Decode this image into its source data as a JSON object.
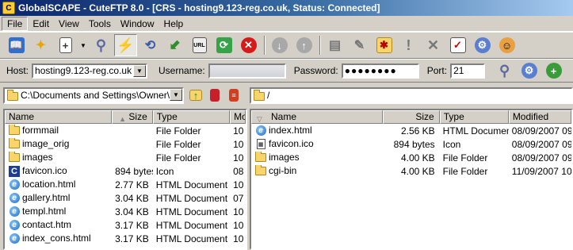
{
  "window": {
    "title": "GlobalSCAPE - CuteFTP 8.0 - [CRS - hosting9.123-reg.co.uk, Status: Connected]"
  },
  "menu": [
    "File",
    "Edit",
    "View",
    "Tools",
    "Window",
    "Help"
  ],
  "toolbar_icons": [
    "open-book-icon",
    "wizard-wand-icon",
    "new-document-icon",
    "dropdown-arrow-icon",
    "connect-icon",
    "quick-connect-icon",
    "reconnect-icon",
    "download-icon",
    "url-icon",
    "refresh-icon",
    "stop-icon",
    "download-arrow-icon",
    "upload-arrow-icon",
    "view-icon",
    "edit-icon",
    "new-folder-icon",
    "exclamation-icon",
    "delete-icon",
    "properties-icon",
    "settings-gear-icon",
    "support-icon"
  ],
  "connection": {
    "host_label": "Host:",
    "host_value": "hosting9.123-reg.co.uk",
    "username_label": "Username:",
    "username_value": "",
    "password_label": "Password:",
    "password_value": "●●●●●●●●",
    "port_label": "Port:",
    "port_value": "21"
  },
  "local": {
    "path": "C:\\Documents and Settings\\Owner\\Des",
    "columns": [
      "Name",
      "Size",
      "Type",
      "Mo"
    ],
    "rows": [
      {
        "name": "formmail",
        "size": "",
        "type": "File Folder",
        "mod": "10",
        "icon": "folder"
      },
      {
        "name": "image_orig",
        "size": "",
        "type": "File Folder",
        "mod": "10",
        "icon": "folder"
      },
      {
        "name": "images",
        "size": "",
        "type": "File Folder",
        "mod": "10",
        "icon": "folder"
      },
      {
        "name": "favicon.ico",
        "size": "894 bytes",
        "type": "Icon",
        "mod": "08",
        "icon": "cuteftp"
      },
      {
        "name": "location.html",
        "size": "2.77 KB",
        "type": "HTML Document",
        "mod": "10",
        "icon": "ie"
      },
      {
        "name": "gallery.html",
        "size": "3.04 KB",
        "type": "HTML Document",
        "mod": "07",
        "icon": "ie"
      },
      {
        "name": "templ.html",
        "size": "3.04 KB",
        "type": "HTML Document",
        "mod": "10",
        "icon": "ie"
      },
      {
        "name": "contact.htm",
        "size": "3.17 KB",
        "type": "HTML Document",
        "mod": "10",
        "icon": "ie"
      },
      {
        "name": "index_cons.html",
        "size": "3.17 KB",
        "type": "HTML Document",
        "mod": "10",
        "icon": "ie"
      }
    ]
  },
  "remote": {
    "path": "/",
    "columns": [
      "Name",
      "Size",
      "Type",
      "Modified"
    ],
    "rows": [
      {
        "name": "index.html",
        "size": "2.56 KB",
        "type": "HTML Document",
        "mod": "08/09/2007 09",
        "icon": "ie"
      },
      {
        "name": "favicon.ico",
        "size": "894 bytes",
        "type": "Icon",
        "mod": "08/09/2007 09",
        "icon": "doc"
      },
      {
        "name": "images",
        "size": "4.00 KB",
        "type": "File Folder",
        "mod": "08/09/2007 09",
        "icon": "folder"
      },
      {
        "name": "cgi-bin",
        "size": "4.00 KB",
        "type": "File Folder",
        "mod": "11/09/2007 10",
        "icon": "folder"
      }
    ]
  },
  "colors": {
    "title_start": "#0a246a",
    "title_end": "#a6caf0",
    "chrome": "#d4d0c8"
  }
}
